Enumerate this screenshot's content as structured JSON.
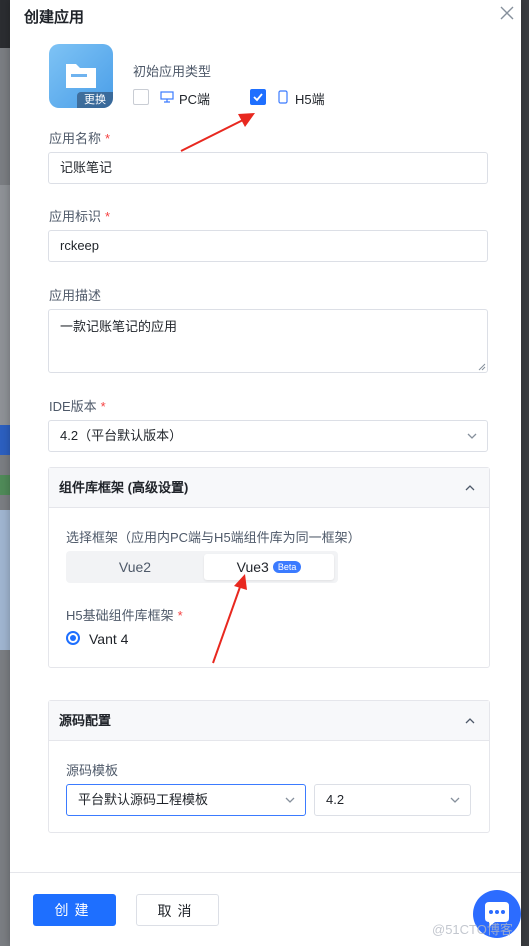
{
  "dialog": {
    "title": "创建应用",
    "close_icon": "close-icon"
  },
  "app_icon": {
    "icon": "folder-icon",
    "replace_label": "更换"
  },
  "app_type": {
    "label": "初始应用类型",
    "options": [
      {
        "label": "PC端",
        "checked": false,
        "icon": "monitor-icon"
      },
      {
        "label": "H5端",
        "checked": true,
        "icon": "mobile-icon"
      }
    ]
  },
  "fields": {
    "name_label": "应用名称",
    "name_value": "记账笔记",
    "id_label": "应用标识",
    "id_value": "rckeep",
    "desc_label": "应用描述",
    "desc_value": "一款记账笔记的应用",
    "ide_label": "IDE版本",
    "ide_value": "4.2（平台默认版本）",
    "required_mark": "*"
  },
  "framework_panel": {
    "title": "组件库框架 (高级设置)",
    "select_label": "选择框架（应用内PC端与H5端组件库为同一框架）",
    "options": [
      "Vue2",
      "Vue3"
    ],
    "selected": "Vue3",
    "beta_badge": "Beta",
    "h5_label": "H5基础组件库框架",
    "h5_option": "Vant 4"
  },
  "source_panel": {
    "title": "源码配置",
    "template_label": "源码模板",
    "template_value": "平台默认源码工程模板",
    "version_value": "4.2"
  },
  "footer": {
    "create_label": "创建",
    "cancel_label": "取消"
  },
  "watermark": "@51CTO博客",
  "colors": {
    "primary": "#1e6fff",
    "required": "#f53f3f",
    "annotation_arrow": "#e8281f"
  }
}
